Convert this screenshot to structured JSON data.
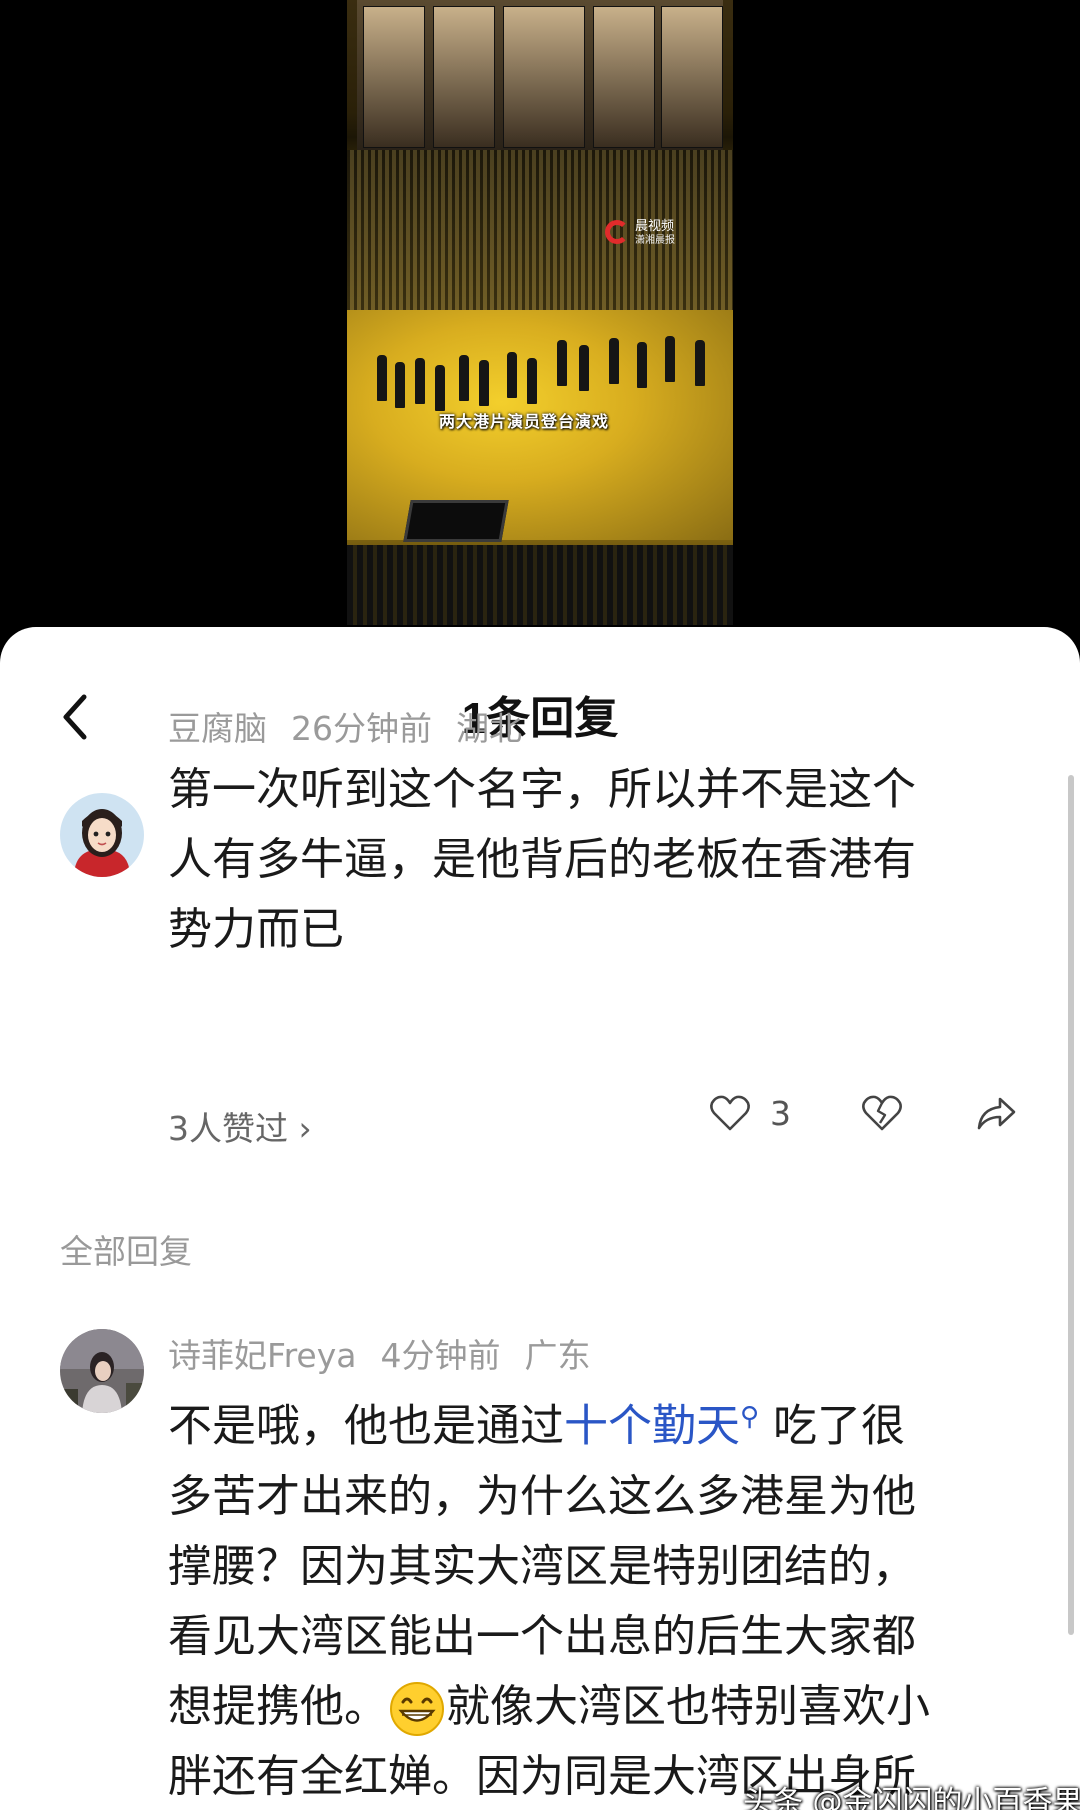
{
  "video": {
    "caption": "两大港片演员登台演戏",
    "logo_text": "晨视频",
    "logo_sub": "潇湘晨报"
  },
  "sheet": {
    "title": "1条回复"
  },
  "main_comment": {
    "username": "豆腐脑",
    "time": "26分钟前",
    "location": "湖北",
    "text_lines": [
      "第一次听到这个名字，所以并不是这个",
      "人有多牛逼，是他背后的老板在香港有",
      "势力而已"
    ],
    "likes_link": "3人赞过 ›",
    "like_count": "3"
  },
  "section": {
    "label": "全部回复"
  },
  "reply": {
    "username": "诗菲妃Freya",
    "time": "4分钟前",
    "location": "广东",
    "line1_before": "不是哦，他也是通过",
    "line1_link": "十个勤天",
    "line1_after": " 吃了很",
    "line2": "多苦才出来的，为什么这么多港星为他",
    "line3": "撑腰？因为其实大湾区是特别团结的，",
    "line4": "看见大湾区能出一个出息的后生大家都",
    "line5_before": "想提携他。",
    "line5_after": "就像大湾区也特别喜欢小",
    "line6": "胖还有全红婵。因为同是大湾区出身所"
  },
  "watermark": "头条 @金闪闪的小百香果",
  "icons": [
    "back-arrow-icon",
    "heart-icon",
    "dislike-icon",
    "share-icon",
    "search-link-icon",
    "grin-emoji-icon"
  ]
}
